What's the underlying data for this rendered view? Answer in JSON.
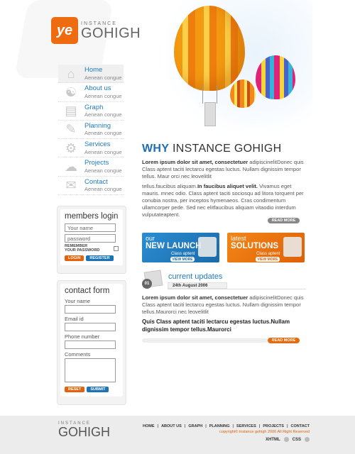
{
  "logo": {
    "small": "INSTANCE",
    "big": "GOHIGH",
    "badge": "ye"
  },
  "nav": [
    {
      "label": "Home",
      "sub": "Aenean congue",
      "icon": "house-icon"
    },
    {
      "label": "About us",
      "sub": "Aenean congue",
      "icon": "people-icon"
    },
    {
      "label": "Graph",
      "sub": "Aenean congue",
      "icon": "graph-icon"
    },
    {
      "label": "Planning",
      "sub": "Aenean congue",
      "icon": "planning-icon"
    },
    {
      "label": "Services",
      "sub": "Aenean congue",
      "icon": "services-icon"
    },
    {
      "label": "Projects",
      "sub": "Aenean congue",
      "icon": "projects-icon"
    },
    {
      "label": "Contact",
      "sub": "Aenean congue",
      "icon": "contact-icon"
    }
  ],
  "login": {
    "title": "members login",
    "username_placeholder": "Your name",
    "password_placeholder": "password",
    "remember_1": "REMEMBER",
    "remember_2": "YOUR PASSWORD",
    "login_btn": "LOGIN",
    "register_btn": "REGISTER"
  },
  "contact": {
    "title": "contact form",
    "name_label": "Your name",
    "email_label": "Email id",
    "phone_label": "Phone number",
    "comments_label": "Comments",
    "reset_btn": "RESET",
    "submit_btn": "SUBMIT"
  },
  "main": {
    "heading_why": "WHY",
    "heading_rest": "INSTANCE GOHIGH",
    "intro_bold": "Lorem ipsum dolor sit amet, consectetuer",
    "intro_rest": "adipiscinelitDonec quis Class aptent taciti lectarcu egestas luctus. Nullam dignissim tempor tellus. Maur orci nec leovelitlit",
    "para2_a": "tellus.faucibus aliquam.",
    "para2_bold": "In faucibus aliquet velit.",
    "para2_b": "Vivamus eget mauris. mnec odio. Class aptent taciti sociosqu ad litora torquent per conubia nostra, per inceptos hymenaeos. Cras condimentum ullamcorper pede. Sed nec elitfaucibus aliquam vitaodio interdum vulputateaptent.",
    "read_more": "READ MORE"
  },
  "promos": [
    {
      "l1": "our",
      "l2": "NEW LAUNCH",
      "l3": "Class aptent",
      "more": "VIEW MORE"
    },
    {
      "l1": "latest",
      "l2": "SOLUTIONS",
      "l3": "Class aptent",
      "more": "VIEW MORE"
    }
  ],
  "updates": {
    "num": "01",
    "title": "current updates",
    "date": "24th August 2006",
    "p_bold": "Lorem ipsum dolor sit amet, consectetuer",
    "p_rest": "adipiscinelitDonec quis Class aptent taciti lectarcu egestas luctus. Nullam dignissim tempor tellus.Maurorci nec leovelitlit",
    "bold_para": "Quis Class aptent taciti lectarcu egestas luctus.Nullam dignissim tempor tellus.Maurorci",
    "read_more": "READ MORE"
  },
  "footer": {
    "logo_small": "INSTANCE",
    "logo_big": "GOHIGH",
    "links": [
      "HOME",
      "ABOUT US",
      "GRAPH",
      "PLANNING",
      "SERVICES",
      "PROJECTS",
      "CONTACT"
    ],
    "copyright": "copyright© instance gohigh 2006 All Right Reserved",
    "xhtml": "XHTML",
    "css": "CSS"
  },
  "colors": {
    "accent_orange": "#e2630b",
    "accent_blue": "#1f6fb2"
  }
}
